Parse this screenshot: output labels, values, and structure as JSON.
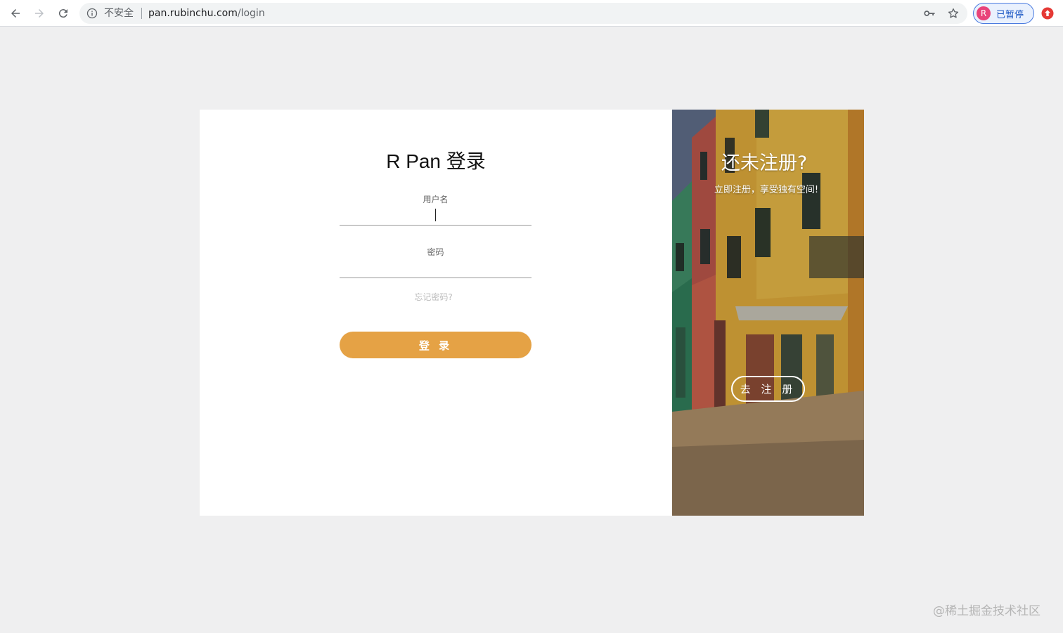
{
  "browser": {
    "security_label": "不安全",
    "url_host": "pan.rubinchu.com",
    "url_path": "/login",
    "profile_initial": "R",
    "profile_status": "已暂停"
  },
  "login": {
    "title": "R Pan 登录",
    "username_label": "用户名",
    "username_value": "",
    "password_label": "密码",
    "password_value": "",
    "forgot_link": "忘记密码?",
    "submit_label": "登 录",
    "submit_color": "#e5a245"
  },
  "register": {
    "title": "还未注册?",
    "subtitle": "立即注册，享受独有空间!",
    "button_label": "去 注 册"
  },
  "watermark": "@稀土掘金技术社区"
}
